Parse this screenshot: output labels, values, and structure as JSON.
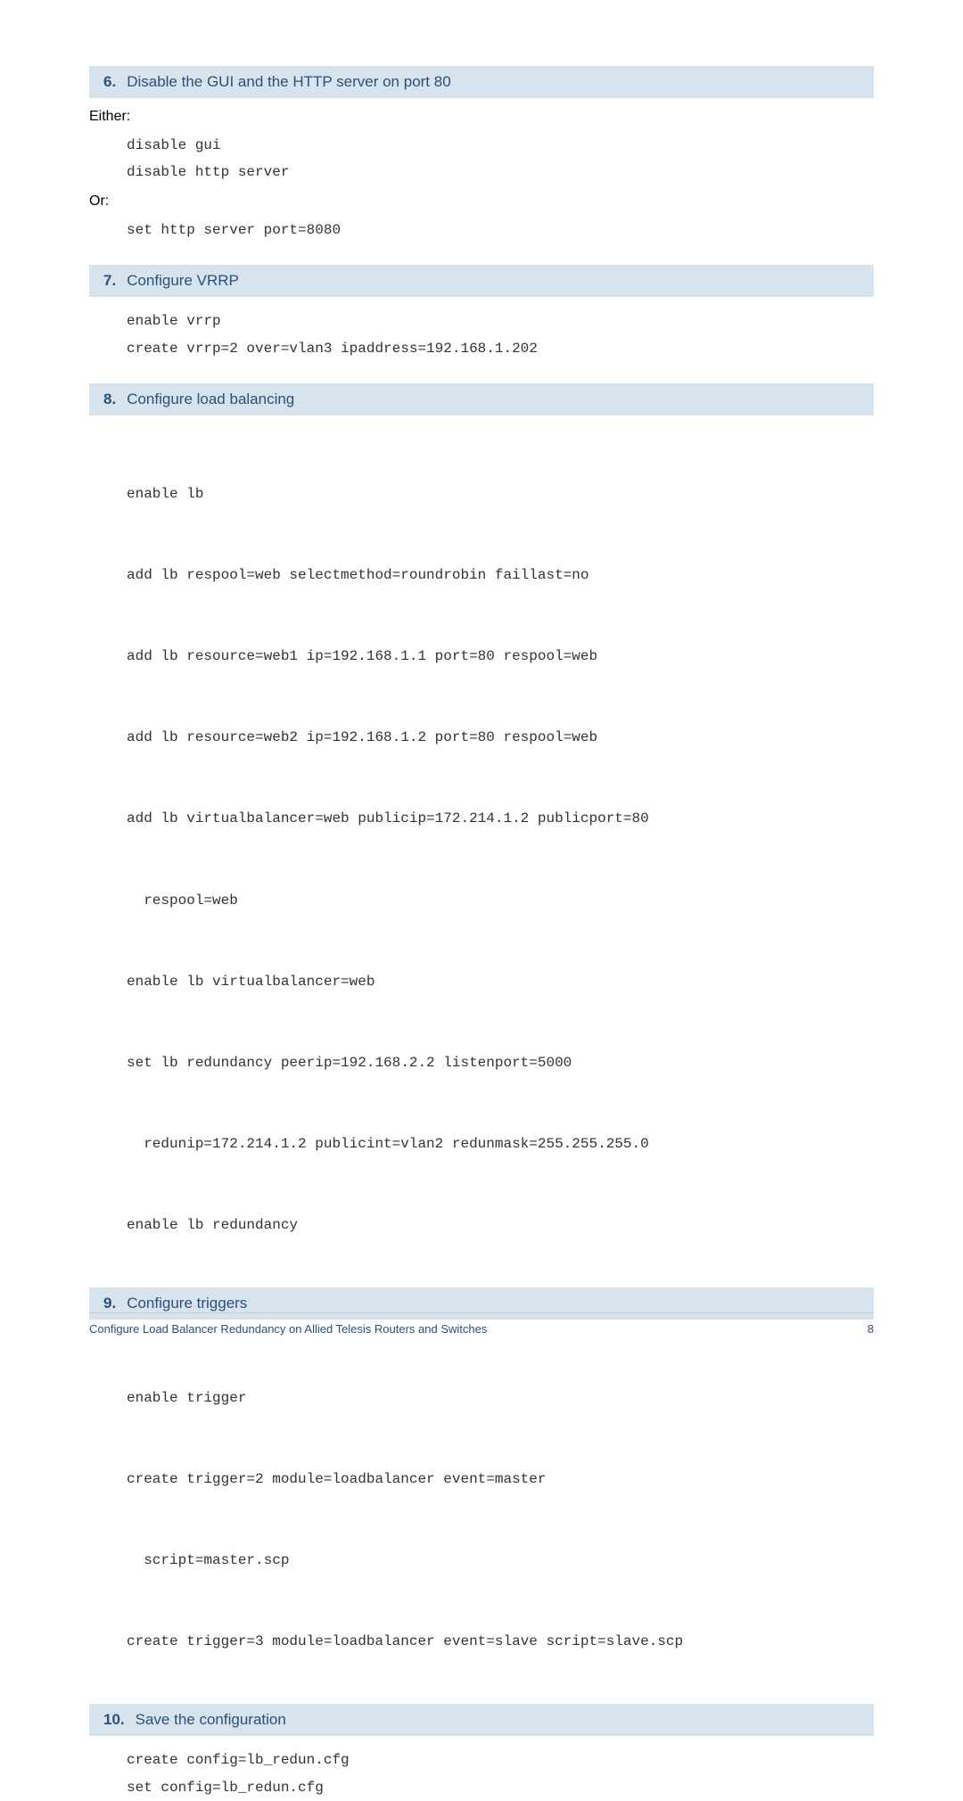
{
  "steps": {
    "s6": {
      "num": "6.",
      "title": "Disable the GUI and the HTTP server on port 80",
      "either_label": "Either:",
      "either_code": "disable gui\ndisable http server",
      "or_label": "Or:",
      "or_code": "set http server port=8080"
    },
    "s7": {
      "num": "7.",
      "title": "Configure VRRP",
      "code": "enable vrrp\ncreate vrrp=2 over=vlan3 ipaddress=192.168.1.202"
    },
    "s8": {
      "num": "8.",
      "title": "Configure load balancing",
      "lines": {
        "l1": "enable lb",
        "l2": "add lb respool=web selectmethod=roundrobin faillast=no",
        "l3": "add lb resource=web1 ip=192.168.1.1 port=80 respool=web",
        "l4": "add lb resource=web2 ip=192.168.1.2 port=80 respool=web",
        "l5a": "add lb virtualbalancer=web publicip=172.214.1.2 publicport=80",
        "l5b": "respool=web",
        "l6": "enable lb virtualbalancer=web",
        "l7a": "set lb redundancy peerip=192.168.2.2 listenport=5000",
        "l7b": "redunip=172.214.1.2 publicint=vlan2 redunmask=255.255.255.0",
        "l8": "enable lb redundancy"
      }
    },
    "s9": {
      "num": "9.",
      "title": "Configure triggers",
      "lines": {
        "l1": "enable trigger",
        "l2a": "create trigger=2 module=loadbalancer event=master",
        "l2b": "script=master.scp",
        "l3": "create trigger=3 module=loadbalancer event=slave script=slave.scp"
      }
    },
    "s10": {
      "num": "10.",
      "title": "Save the configuration",
      "code": "create config=lb_redun.cfg\nset config=lb_redun.cfg"
    }
  },
  "footer": {
    "left": "Configure Load Balancer Redundancy on Allied Telesis Routers and Switches",
    "right": "8"
  }
}
